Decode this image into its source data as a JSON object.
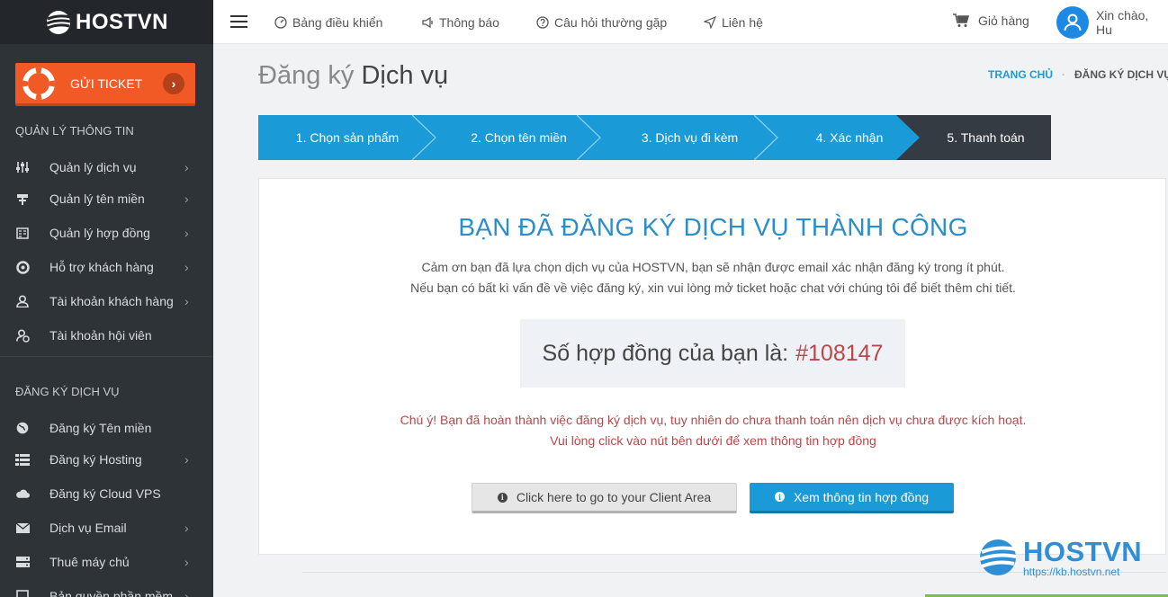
{
  "sidebar": {
    "logo_text": "HOSTVN",
    "ticket_label": "GỬI TICKET",
    "section1_heading": "QUẢN LÝ THÔNG TIN",
    "section1_items": [
      {
        "label": "Quản lý dịch vụ",
        "icon": "sliders-icon",
        "has_submenu": true
      },
      {
        "label": "Quản lý tên miền",
        "icon": "signpost-icon",
        "has_submenu": true
      },
      {
        "label": "Quản lý hợp đồng",
        "icon": "contract-icon",
        "has_submenu": true
      },
      {
        "label": "Hỗ trợ khách hàng",
        "icon": "lifebuoy-icon",
        "has_submenu": true
      },
      {
        "label": "Tài khoản khách hàng",
        "icon": "user-icon",
        "has_submenu": true
      },
      {
        "label": "Tài khoản hội viên",
        "icon": "member-icon",
        "has_submenu": false
      }
    ],
    "section2_heading": "ĐĂNG KÝ DỊCH VỤ",
    "section2_items": [
      {
        "label": "Đăng ký Tên miền",
        "icon": "globe-icon",
        "has_submenu": false
      },
      {
        "label": "Đăng ký Hosting",
        "icon": "server-list-icon",
        "has_submenu": true
      },
      {
        "label": "Đăng ký Cloud VPS",
        "icon": "cloud-icon",
        "has_submenu": false
      },
      {
        "label": "Dịch vụ Email",
        "icon": "envelope-icon",
        "has_submenu": true
      },
      {
        "label": "Thuê máy chủ",
        "icon": "server-icon",
        "has_submenu": true
      },
      {
        "label": "Bản quyền phần mềm",
        "icon": "software-icon",
        "has_submenu": true
      }
    ]
  },
  "topbar": {
    "nav": [
      "Bảng điều khiển",
      "Thông báo",
      "Câu hỏi thường gặp",
      "Liên hệ"
    ],
    "cart_label": "Giỏ hàng",
    "greeting": "Xin chào, Hu"
  },
  "page": {
    "title_light": "Đăng ký",
    "title_strong": "Dịch vụ",
    "breadcrumb_home": "TRANG CHỦ",
    "breadcrumb_current": "ĐĂNG KÝ DỊCH VỤ"
  },
  "steps": [
    {
      "label": "1. Chọn sản phẩm",
      "active": false
    },
    {
      "label": "2. Chọn tên miền",
      "active": false
    },
    {
      "label": "3. Dịch vụ đi kèm",
      "active": false
    },
    {
      "label": "4. Xác nhận",
      "active": false
    },
    {
      "label": "5. Thanh toán",
      "active": true
    }
  ],
  "result": {
    "title": "BẠN ĐÃ ĐĂNG KÝ DỊCH VỤ THÀNH CÔNG",
    "line1": "Cảm ơn bạn đã lựa chọn dịch vụ của HOSTVN, bạn sẽ nhận được email xác nhận đăng ký trong ít phút.",
    "line2": "Nếu bạn có bất kì vấn đề về việc đăng ký, xin vui lòng mở ticket hoặc chat với chúng tôi để biết thêm chi tiết.",
    "contract_label": "Số hợp đồng của bạn là:",
    "contract_number": "#108147",
    "warning1": "Chú ý! Bạn đã hoàn thành việc đăng ký dịch vụ, tuy nhiên do chưa thanh toán nên dịch vụ chưa được kích hoạt.",
    "warning2": "Vui lòng click vào nút bên dưới để xem thông tin hợp đồng",
    "btn_client_area": "Click here to go to your Client Area",
    "btn_view_contract": "Xem thông tin hợp đồng"
  },
  "watermark": {
    "brand": "HOSTVN",
    "url": "https://kb.hostvn.net"
  },
  "colors": {
    "sidebar_bg": "#2e3338",
    "accent_blue": "#1a9bd7",
    "ticket_orange": "#f15a24",
    "warning_red": "#b9474a",
    "active_step": "#353b42"
  }
}
